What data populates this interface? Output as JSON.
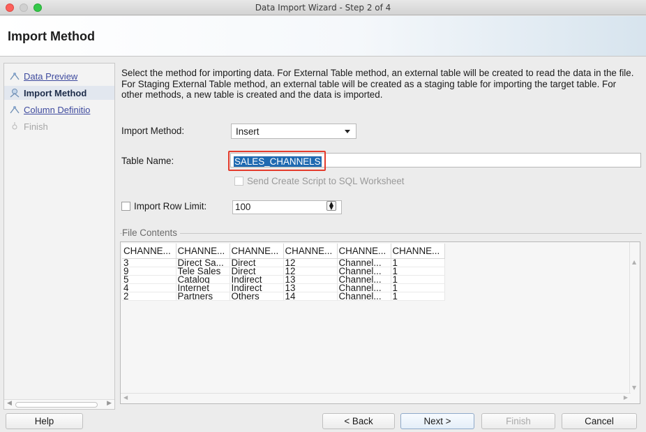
{
  "window": {
    "title": "Data Import Wizard - Step 2 of 4"
  },
  "header": {
    "title": "Import Method"
  },
  "nav": {
    "items": [
      {
        "label": "Data Preview",
        "state": "link"
      },
      {
        "label": "Import Method",
        "state": "current"
      },
      {
        "label": "Column Definitio",
        "state": "link"
      },
      {
        "label": "Finish",
        "state": "disabled"
      }
    ]
  },
  "content": {
    "description": "Select the method for importing data.  For External Table method, an external table will be created to read the data in the file.  For Staging External Table method, an external table will be created as a staging table for importing the target table.  For other methods, a new table is created and the data is imported.",
    "import_method_label": "Import Method:",
    "import_method_value": "Insert",
    "table_name_label": "Table Name:",
    "table_name_value": "SALES_CHANNELS",
    "send_script_label": "Send Create Script to SQL Worksheet",
    "row_limit_label": "Import Row Limit:",
    "row_limit_value": "100",
    "file_contents_label": "File Contents"
  },
  "grid": {
    "headers": [
      "CHANNE...",
      "CHANNE...",
      "CHANNE...",
      "CHANNE...",
      "CHANNE...",
      "CHANNE..."
    ],
    "rows": [
      [
        "3",
        "Direct Sa...",
        "Direct",
        "12",
        "Channel...",
        "1"
      ],
      [
        "9",
        "Tele Sales",
        "Direct",
        "12",
        "Channel...",
        "1"
      ],
      [
        "5",
        "Catalog",
        "Indirect",
        "13",
        "Channel...",
        "1"
      ],
      [
        "4",
        "Internet",
        "Indirect",
        "13",
        "Channel...",
        "1"
      ],
      [
        "2",
        "Partners",
        "Others",
        "14",
        "Channel...",
        "1"
      ]
    ]
  },
  "buttons": {
    "help": "Help",
    "back": "< Back",
    "next": "Next >",
    "finish": "Finish",
    "cancel": "Cancel"
  },
  "colors": {
    "highlight_border": "#e43b2c",
    "selection": "#1f6ab1",
    "link": "#3e4a9e"
  }
}
